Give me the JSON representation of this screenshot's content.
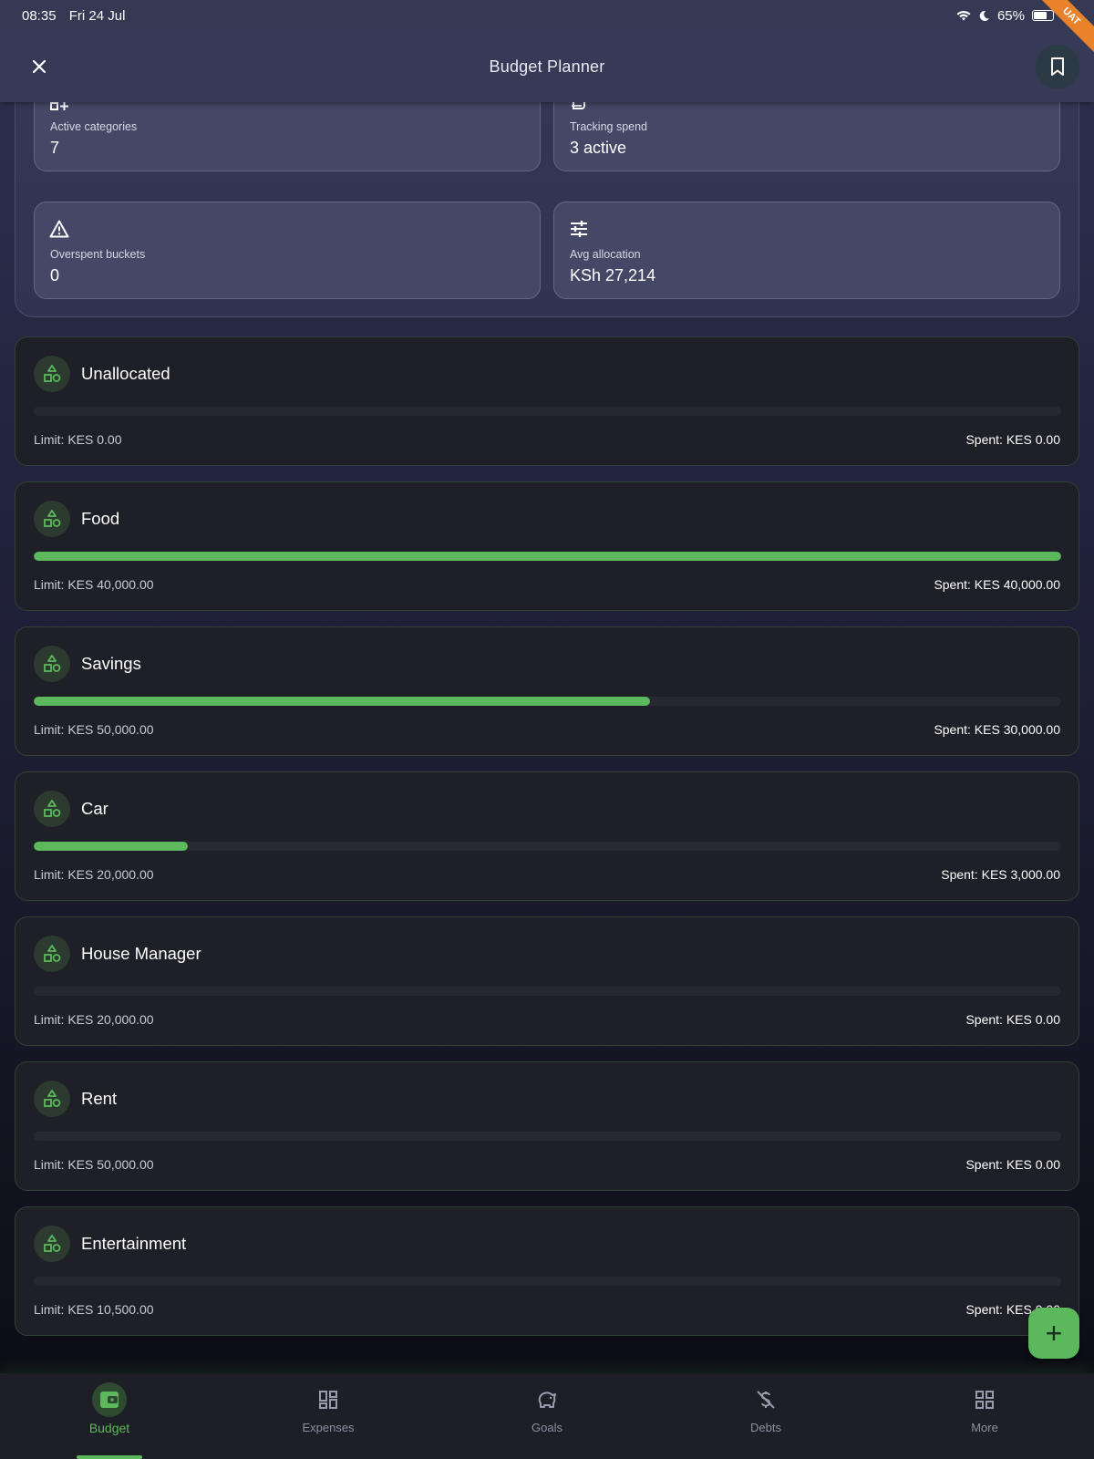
{
  "status_bar": {
    "time": "08:35",
    "date": "Fri 24 Jul",
    "battery": "65%",
    "ribbon": "UAT"
  },
  "app_bar": {
    "title": "Budget Planner"
  },
  "stats": [
    {
      "label": "Active categories",
      "value": "7",
      "icon": "grid-plus-icon"
    },
    {
      "label": "Tracking spend",
      "value": "3 active",
      "icon": "receipt-icon"
    },
    {
      "label": "Overspent buckets",
      "value": "0",
      "icon": "warning-icon"
    },
    {
      "label": "Avg allocation",
      "value": "KSh 27,214",
      "icon": "sliders-icon"
    }
  ],
  "budgets": [
    {
      "name": "Unallocated",
      "limit": "Limit: KES 0.00",
      "spent": "Spent: KES 0.00",
      "progress": 0
    },
    {
      "name": "Food",
      "limit": "Limit: KES 40,000.00",
      "spent": "Spent: KES 40,000.00",
      "progress": 1.0
    },
    {
      "name": "Savings",
      "limit": "Limit: KES 50,000.00",
      "spent": "Spent: KES 30,000.00",
      "progress": 0.6
    },
    {
      "name": "Car",
      "limit": "Limit: KES 20,000.00",
      "spent": "Spent: KES 3,000.00",
      "progress": 0.15
    },
    {
      "name": "House Manager",
      "limit": "Limit: KES 20,000.00",
      "spent": "Spent: KES 0.00",
      "progress": 0
    },
    {
      "name": "Rent",
      "limit": "Limit: KES 50,000.00",
      "spent": "Spent: KES 0.00",
      "progress": 0
    },
    {
      "name": "Entertainment",
      "limit": "Limit: KES 10,500.00",
      "spent": "Spent: KES 0.00",
      "progress": 0
    }
  ],
  "fab": {
    "label": "+"
  },
  "nav": [
    {
      "label": "Budget",
      "icon": "wallet-icon",
      "active": true
    },
    {
      "label": "Expenses",
      "icon": "dashboard-icon",
      "active": false
    },
    {
      "label": "Goals",
      "icon": "piggy-bank-icon",
      "active": false
    },
    {
      "label": "Debts",
      "icon": "money-off-icon",
      "active": false
    },
    {
      "label": "More",
      "icon": "grid-icon",
      "active": false
    }
  ],
  "colors": {
    "accent": "#5cb85c",
    "card": "#1f1f28",
    "track": "#282833"
  }
}
